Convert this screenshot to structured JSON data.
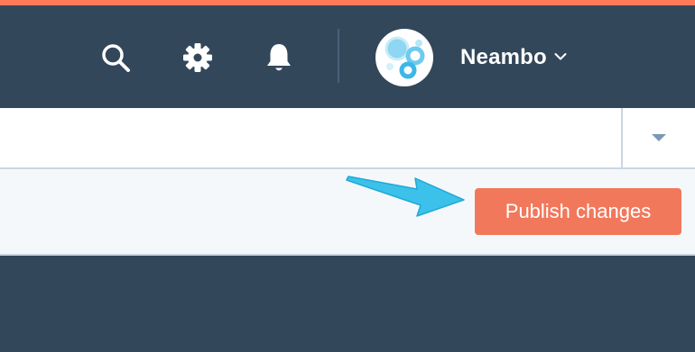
{
  "colors": {
    "accent_bar": "#ff7a59",
    "navbar_bg": "#33475b",
    "publish_button_bg": "#f2785c",
    "annotation_arrow": "#3cc2ea"
  },
  "navbar": {
    "icons": [
      "search-icon",
      "gear-icon",
      "bell-icon",
      "chevron-down-icon"
    ],
    "account_name": "Neambo"
  },
  "action_bar": {
    "publish_label": "Publish changes"
  },
  "annotation": {
    "type": "arrow",
    "points_to": "publish-changes-button"
  }
}
